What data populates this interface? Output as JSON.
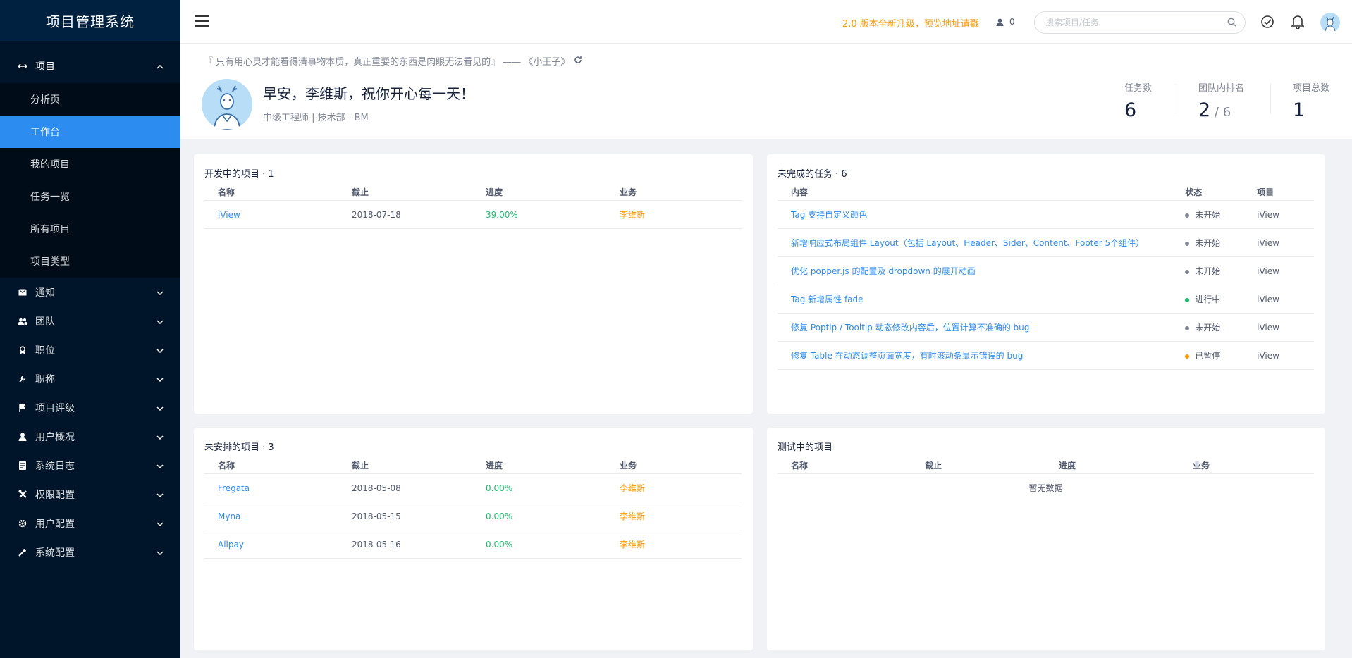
{
  "sidebar": {
    "logo": "项目管理系统",
    "project_group": {
      "label": "项目",
      "icon": "swap-arrows-icon"
    },
    "project_items": [
      {
        "label": "分析页",
        "active": false
      },
      {
        "label": "工作台",
        "active": true
      },
      {
        "label": "我的项目",
        "active": false
      },
      {
        "label": "任务一览",
        "active": false
      },
      {
        "label": "所有项目",
        "active": false
      },
      {
        "label": "项目类型",
        "active": false
      }
    ],
    "menu": [
      {
        "label": "通知",
        "icon": "mail-icon"
      },
      {
        "label": "团队",
        "icon": "team-icon"
      },
      {
        "label": "职位",
        "icon": "badge-icon"
      },
      {
        "label": "职称",
        "icon": "wrench-icon"
      },
      {
        "label": "项目评级",
        "icon": "flag-icon"
      },
      {
        "label": "用户概况",
        "icon": "user-icon"
      },
      {
        "label": "系统日志",
        "icon": "log-icon"
      },
      {
        "label": "权限配置",
        "icon": "tools-icon"
      },
      {
        "label": "用户配置",
        "icon": "gear-icon"
      },
      {
        "label": "系统配置",
        "icon": "hammer-icon"
      }
    ]
  },
  "header": {
    "notice": "2.0 版本全新升级，预览地址请戳",
    "online_count": "0",
    "search_placeholder": "搜索项目/任务",
    "icons": [
      "menu-icon",
      "person-icon",
      "search-icon",
      "check-circle-icon",
      "bell-icon",
      "avatar"
    ]
  },
  "welcome": {
    "quote": "『 只有用心灵才能看得清事物本质，真正重要的东西是肉眼无法看见的』 —— 《小王子》",
    "greeting": "早安，李维斯，祝你开心每一天！",
    "role": "中级工程师 | 技术部 - BM",
    "stats": {
      "tasks_label": "任务数",
      "tasks_value": "6",
      "rank_label": "团队内排名",
      "rank_value": "2",
      "rank_total": " / 6",
      "projects_label": "项目总数",
      "projects_value": "1"
    }
  },
  "dev_projects": {
    "title": "开发中的项目 · 1",
    "columns": [
      "名称",
      "截止",
      "进度",
      "业务"
    ],
    "rows": [
      {
        "name": "iView",
        "deadline": "2018-07-18",
        "progress": "39.00%",
        "owner": "李维斯"
      }
    ]
  },
  "unfinished_tasks": {
    "title": "未完成的任务 · 6",
    "columns": [
      "内容",
      "状态",
      "项目"
    ],
    "rows": [
      {
        "content": "Tag 支持自定义颜色",
        "status": "未开始",
        "status_color": "#808695",
        "project": "iView"
      },
      {
        "content": "新增响应式布局组件 Layout（包括 Layout、Header、Sider、Content、Footer 5个组件）",
        "status": "未开始",
        "status_color": "#808695",
        "project": "iView"
      },
      {
        "content": "优化 popper.js 的配置及 dropdown 的展开动画",
        "status": "未开始",
        "status_color": "#808695",
        "project": "iView"
      },
      {
        "content": "Tag 新增属性 fade",
        "status": "进行中",
        "status_color": "#19be6b",
        "project": "iView"
      },
      {
        "content": "修复 Poptip / Tooltip 动态修改内容后，位置计算不准确的 bug",
        "status": "未开始",
        "status_color": "#808695",
        "project": "iView"
      },
      {
        "content": "修复 Table 在动态调整页面宽度，有时滚动条显示错误的 bug",
        "status": "已暂停",
        "status_color": "#ff9900",
        "project": "iView"
      }
    ]
  },
  "unscheduled_projects": {
    "title": "未安排的项目 · 3",
    "columns": [
      "名称",
      "截止",
      "进度",
      "业务"
    ],
    "rows": [
      {
        "name": "Fregata",
        "deadline": "2018-05-08",
        "progress": "0.00%",
        "owner": "李维斯"
      },
      {
        "name": "Myna",
        "deadline": "2018-05-15",
        "progress": "0.00%",
        "owner": "李维斯"
      },
      {
        "name": "Alipay",
        "deadline": "2018-05-16",
        "progress": "0.00%",
        "owner": "李维斯"
      }
    ]
  },
  "testing_projects": {
    "title": "测试中的项目",
    "columns": [
      "名称",
      "截止",
      "进度",
      "业务"
    ],
    "empty_text": "暂无数据"
  }
}
